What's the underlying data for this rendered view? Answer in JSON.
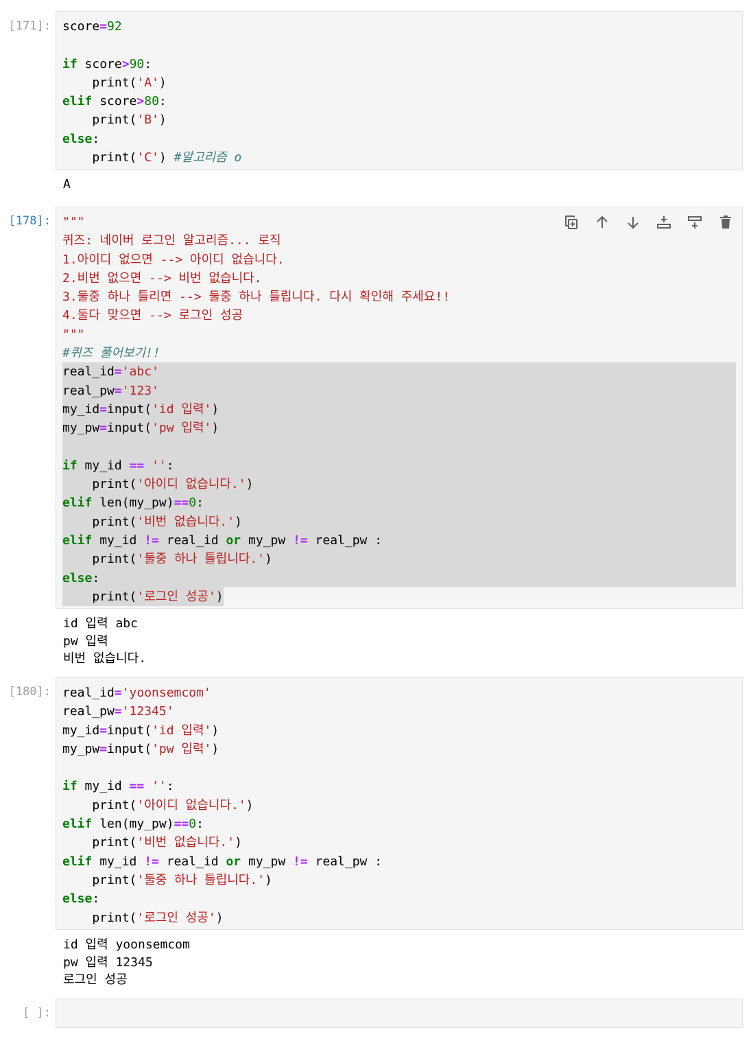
{
  "cells": [
    {
      "prompt": "[171]:",
      "lines": [
        [
          [
            "score",
            "n"
          ],
          [
            "=",
            "o"
          ],
          [
            "92",
            "d"
          ]
        ],
        [],
        [
          [
            "if",
            "k"
          ],
          [
            " score",
            "n"
          ],
          [
            ">",
            "o"
          ],
          [
            "90",
            "d"
          ],
          [
            ":",
            "n"
          ]
        ],
        [
          [
            "    print(",
            "n"
          ],
          [
            "'A'",
            "s"
          ],
          [
            ")",
            "n"
          ]
        ],
        [
          [
            "elif",
            "k"
          ],
          [
            " score",
            "n"
          ],
          [
            ">",
            "o"
          ],
          [
            "80",
            "d"
          ],
          [
            ":",
            "n"
          ]
        ],
        [
          [
            "    print(",
            "n"
          ],
          [
            "'B'",
            "s"
          ],
          [
            ")",
            "n"
          ]
        ],
        [
          [
            "else",
            "k"
          ],
          [
            ":",
            "n"
          ]
        ],
        [
          [
            "    print(",
            "n"
          ],
          [
            "'C'",
            "s"
          ],
          [
            ") ",
            "n"
          ],
          [
            "#알고리즘 o",
            "c"
          ]
        ]
      ],
      "output": "A"
    },
    {
      "prompt": "[178]:",
      "lines": [
        [
          [
            "\"\"\"",
            "s"
          ]
        ],
        [
          [
            "퀴즈: 네이버 로그인 알고리즘... 로직",
            "s"
          ]
        ],
        [
          [
            "1.아이디 없으면 --> 아이디 없습니다.",
            "s"
          ]
        ],
        [
          [
            "2.비번 없으면 --> 비번 없습니다.",
            "s"
          ]
        ],
        [
          [
            "3.둘중 하나 틀리면 --> 둘중 하나 틀립니다. 다시 확인해 주세요!!",
            "s"
          ]
        ],
        [
          [
            "4.둘다 맞으면 --> 로그인 성공",
            "s"
          ]
        ],
        [
          [
            "\"\"\"",
            "s"
          ]
        ],
        [
          [
            "#퀴즈 풀어보기!!",
            "c"
          ]
        ],
        [
          [
            "real_id",
            "n"
          ],
          [
            "=",
            "o"
          ],
          [
            "'abc'",
            "s"
          ]
        ],
        [
          [
            "real_pw",
            "n"
          ],
          [
            "=",
            "o"
          ],
          [
            "'123'",
            "s"
          ]
        ],
        [
          [
            "my_id",
            "n"
          ],
          [
            "=",
            "o"
          ],
          [
            "input(",
            "n"
          ],
          [
            "'id 입력'",
            "s"
          ],
          [
            ")",
            "n"
          ]
        ],
        [
          [
            "my_pw",
            "n"
          ],
          [
            "=",
            "o"
          ],
          [
            "input(",
            "n"
          ],
          [
            "'pw 입력'",
            "s"
          ],
          [
            ")",
            "n"
          ]
        ],
        [],
        [
          [
            "if",
            "k"
          ],
          [
            " my_id ",
            "n"
          ],
          [
            "==",
            "o"
          ],
          [
            " ",
            "n"
          ],
          [
            "''",
            "s"
          ],
          [
            ":",
            "n"
          ]
        ],
        [
          [
            "    print(",
            "n"
          ],
          [
            "'아이디 없습니다.'",
            "s"
          ],
          [
            ")",
            "n"
          ]
        ],
        [
          [
            "elif",
            "k"
          ],
          [
            " len(my_pw)",
            "n"
          ],
          [
            "==",
            "o"
          ],
          [
            "0",
            "d"
          ],
          [
            ":",
            "n"
          ]
        ],
        [
          [
            "    print(",
            "n"
          ],
          [
            "'비번 없습니다.'",
            "s"
          ],
          [
            ")",
            "n"
          ]
        ],
        [
          [
            "elif",
            "k"
          ],
          [
            " my_id ",
            "n"
          ],
          [
            "!=",
            "o"
          ],
          [
            " real_id ",
            "n"
          ],
          [
            "or",
            "k"
          ],
          [
            " my_pw ",
            "n"
          ],
          [
            "!=",
            "o"
          ],
          [
            " real_pw :",
            "n"
          ]
        ],
        [
          [
            "    print(",
            "n"
          ],
          [
            "'둘중 하나 틀립니다.'",
            "s"
          ],
          [
            ")",
            "n"
          ]
        ],
        [
          [
            "else",
            "k"
          ],
          [
            ":",
            "n"
          ]
        ],
        [
          [
            "    print(",
            "n"
          ],
          [
            "'로그인 성공'",
            "s"
          ],
          [
            ")",
            "n"
          ]
        ]
      ],
      "output": "id 입력 abc\npw 입력\n비번 없습니다.",
      "toolbar": [
        "duplicate-icon",
        "move-up-icon",
        "move-down-icon",
        "insert-above-icon",
        "insert-below-icon",
        "delete-icon"
      ]
    },
    {
      "prompt": "[180]:",
      "lines": [
        [
          [
            "real_id",
            "n"
          ],
          [
            "=",
            "o"
          ],
          [
            "'yoonsemcom'",
            "s"
          ]
        ],
        [
          [
            "real_pw",
            "n"
          ],
          [
            "=",
            "o"
          ],
          [
            "'12345'",
            "s"
          ]
        ],
        [
          [
            "my_id",
            "n"
          ],
          [
            "=",
            "o"
          ],
          [
            "input(",
            "n"
          ],
          [
            "'id 입력'",
            "s"
          ],
          [
            ")",
            "n"
          ]
        ],
        [
          [
            "my_pw",
            "n"
          ],
          [
            "=",
            "o"
          ],
          [
            "input(",
            "n"
          ],
          [
            "'pw 입력'",
            "s"
          ],
          [
            ")",
            "n"
          ]
        ],
        [],
        [
          [
            "if",
            "k"
          ],
          [
            " my_id ",
            "n"
          ],
          [
            "==",
            "o"
          ],
          [
            " ",
            "n"
          ],
          [
            "''",
            "s"
          ],
          [
            ":",
            "n"
          ]
        ],
        [
          [
            "    print(",
            "n"
          ],
          [
            "'아이디 없습니다.'",
            "s"
          ],
          [
            ")",
            "n"
          ]
        ],
        [
          [
            "elif",
            "k"
          ],
          [
            " len(my_pw)",
            "n"
          ],
          [
            "==",
            "o"
          ],
          [
            "0",
            "d"
          ],
          [
            ":",
            "n"
          ]
        ],
        [
          [
            "    print(",
            "n"
          ],
          [
            "'비번 없습니다.'",
            "s"
          ],
          [
            ")",
            "n"
          ]
        ],
        [
          [
            "elif",
            "k"
          ],
          [
            " my_id ",
            "n"
          ],
          [
            "!=",
            "o"
          ],
          [
            " real_id ",
            "n"
          ],
          [
            "or",
            "k"
          ],
          [
            " my_pw ",
            "n"
          ],
          [
            "!=",
            "o"
          ],
          [
            " real_pw :",
            "n"
          ]
        ],
        [
          [
            "    print(",
            "n"
          ],
          [
            "'둘중 하나 틀립니다.'",
            "s"
          ],
          [
            ")",
            "n"
          ]
        ],
        [
          [
            "else",
            "k"
          ],
          [
            ":",
            "n"
          ]
        ],
        [
          [
            "    print(",
            "n"
          ],
          [
            "'로그인 성공'",
            "s"
          ],
          [
            ")",
            "n"
          ]
        ]
      ],
      "output": "id 입력 yoonsemcom\npw 입력 12345\n로그인 성공"
    },
    {
      "prompt": "[ ]:",
      "lines": [],
      "output": ""
    }
  ]
}
